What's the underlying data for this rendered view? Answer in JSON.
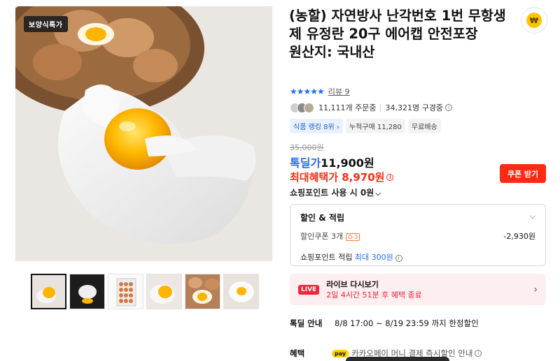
{
  "gallery": {
    "brand_badge": "보양식특가",
    "thumb_count": 6,
    "active_thumb": 0
  },
  "product": {
    "title": "(농할) 자연방사 난각번호 1번 무항생제 유정란 20구 에어캡 안전포장",
    "origin": "원산지: 국내산"
  },
  "rating": {
    "stars": "★★★★★",
    "review_link": "리뷰 9"
  },
  "stats": {
    "orders": "11,111개 주문중",
    "subscribers": "34,321명 구경중"
  },
  "tags": [
    {
      "label": "식품 랭킹 8위 ›",
      "style": "blue"
    },
    {
      "label": "누적구매 11,280",
      "style": "gray"
    },
    {
      "label": "무료배송",
      "style": "gray"
    }
  ],
  "price": {
    "original": "35,000원",
    "deal_label": "톡딜가",
    "deal_value": "11,900원",
    "max_benefit": "최대혜택가 8,970원",
    "coupon_button": "쿠폰 받기",
    "point_use": "쇼핑포인트 사용 시 0원"
  },
  "benefit_box": {
    "title": "할인 & 적립",
    "coupon_label": "할인쿠폰 3개",
    "coupon_dday": "D-3",
    "coupon_amount": "-2,930원",
    "point_label": "쇼핑포인트 적립",
    "point_value": "최대 300원"
  },
  "live": {
    "badge": "LIVE",
    "title": "라이브 다시보기",
    "subtitle": "2일 4시간 51분 후 혜택 종료"
  },
  "special": {
    "label": "톡딜 안내",
    "value": "8/8 17:00 ~ 8/19 23:59 까지 한정할인"
  },
  "benefit_row": {
    "label": "혜택",
    "pay_badge": "pay",
    "text": "카카오페이 머니 결제 즉시할인 안내"
  },
  "colors": {
    "accent_blue": "#1f6df4",
    "accent_red": "#ff2a16",
    "live_pink": "#fdeef0"
  }
}
